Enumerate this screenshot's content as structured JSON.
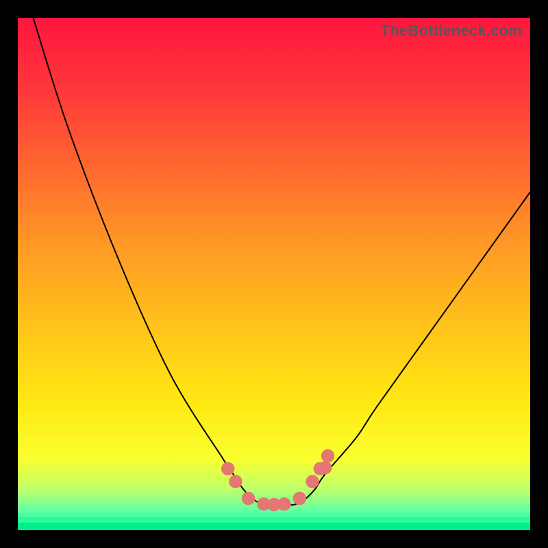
{
  "watermark": "TheBottleneck.com",
  "colors": {
    "black": "#000000",
    "curve": "#000000",
    "marker": "#e47771",
    "gradient_stops": [
      {
        "offset": 0.0,
        "color": "#ff153f"
      },
      {
        "offset": 0.15,
        "color": "#ff3a3a"
      },
      {
        "offset": 0.3,
        "color": "#ff6a2f"
      },
      {
        "offset": 0.45,
        "color": "#ff9b25"
      },
      {
        "offset": 0.6,
        "color": "#ffc21a"
      },
      {
        "offset": 0.75,
        "color": "#ffe812"
      },
      {
        "offset": 0.86,
        "color": "#faff2f"
      },
      {
        "offset": 0.92,
        "color": "#bfff6a"
      },
      {
        "offset": 0.965,
        "color": "#5dffa4"
      },
      {
        "offset": 1.0,
        "color": "#00ff9d"
      }
    ],
    "green_strip_top": "#5effa9",
    "green_strip_bot": "#00ef8e"
  },
  "chart_data": {
    "type": "line",
    "title": "",
    "xlabel": "",
    "ylabel": "",
    "xlim": [
      0,
      100
    ],
    "ylim": [
      0,
      100
    ],
    "x": [
      3,
      10,
      20,
      30,
      40,
      42,
      44,
      46,
      48,
      50,
      52,
      54,
      56,
      58,
      60,
      66,
      70,
      80,
      90,
      100
    ],
    "y": [
      100,
      78,
      52,
      30,
      14,
      11,
      8,
      6,
      5,
      5,
      5,
      5,
      6,
      8,
      11,
      18,
      24,
      38,
      52,
      66
    ],
    "markers_x": [
      41.0,
      42.5,
      45.0,
      48.0,
      50.0,
      52.0,
      55.0,
      57.5,
      59.0,
      60.0,
      60.5
    ],
    "markers_y": [
      12.0,
      9.5,
      6.2,
      5.1,
      5.0,
      5.1,
      6.2,
      9.5,
      12.0,
      12.2,
      14.5
    ],
    "marker_radius": 1.3,
    "notes": "V-shaped bottleneck curve over a vertical red→yellow→green gradient. Values are approximate, read from the image; axes are unlabeled so x/y are treated as 0–100 percent of the plot area (y measured from bottom)."
  }
}
